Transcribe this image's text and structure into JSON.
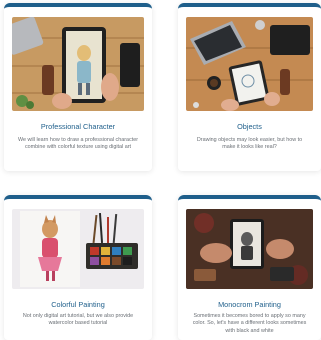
{
  "cards": [
    {
      "title": "Professional Character",
      "description": "We will learn how to draw a professional character combine with colorful texture using digital art",
      "image": "tablet-drawing-photo"
    },
    {
      "title": "Objects",
      "description": "Drawing objects may look easier, but how to make it looks like real?",
      "image": "desk-sketch-photo"
    },
    {
      "title": "Colorful Painting",
      "description": "Not only digital art tutorial, but we also provide watercolor based tutorial",
      "image": "watercolor-paint-photo"
    },
    {
      "title": "Monocrom Painting",
      "description": "Sometimes it becomes bored to apply so many color. So, let's have a different looks sometimes with black and white",
      "image": "monochrome-tablet-photo"
    }
  ],
  "colors": {
    "accent": "#1f5f8b",
    "text_muted": "#6a6f75"
  }
}
